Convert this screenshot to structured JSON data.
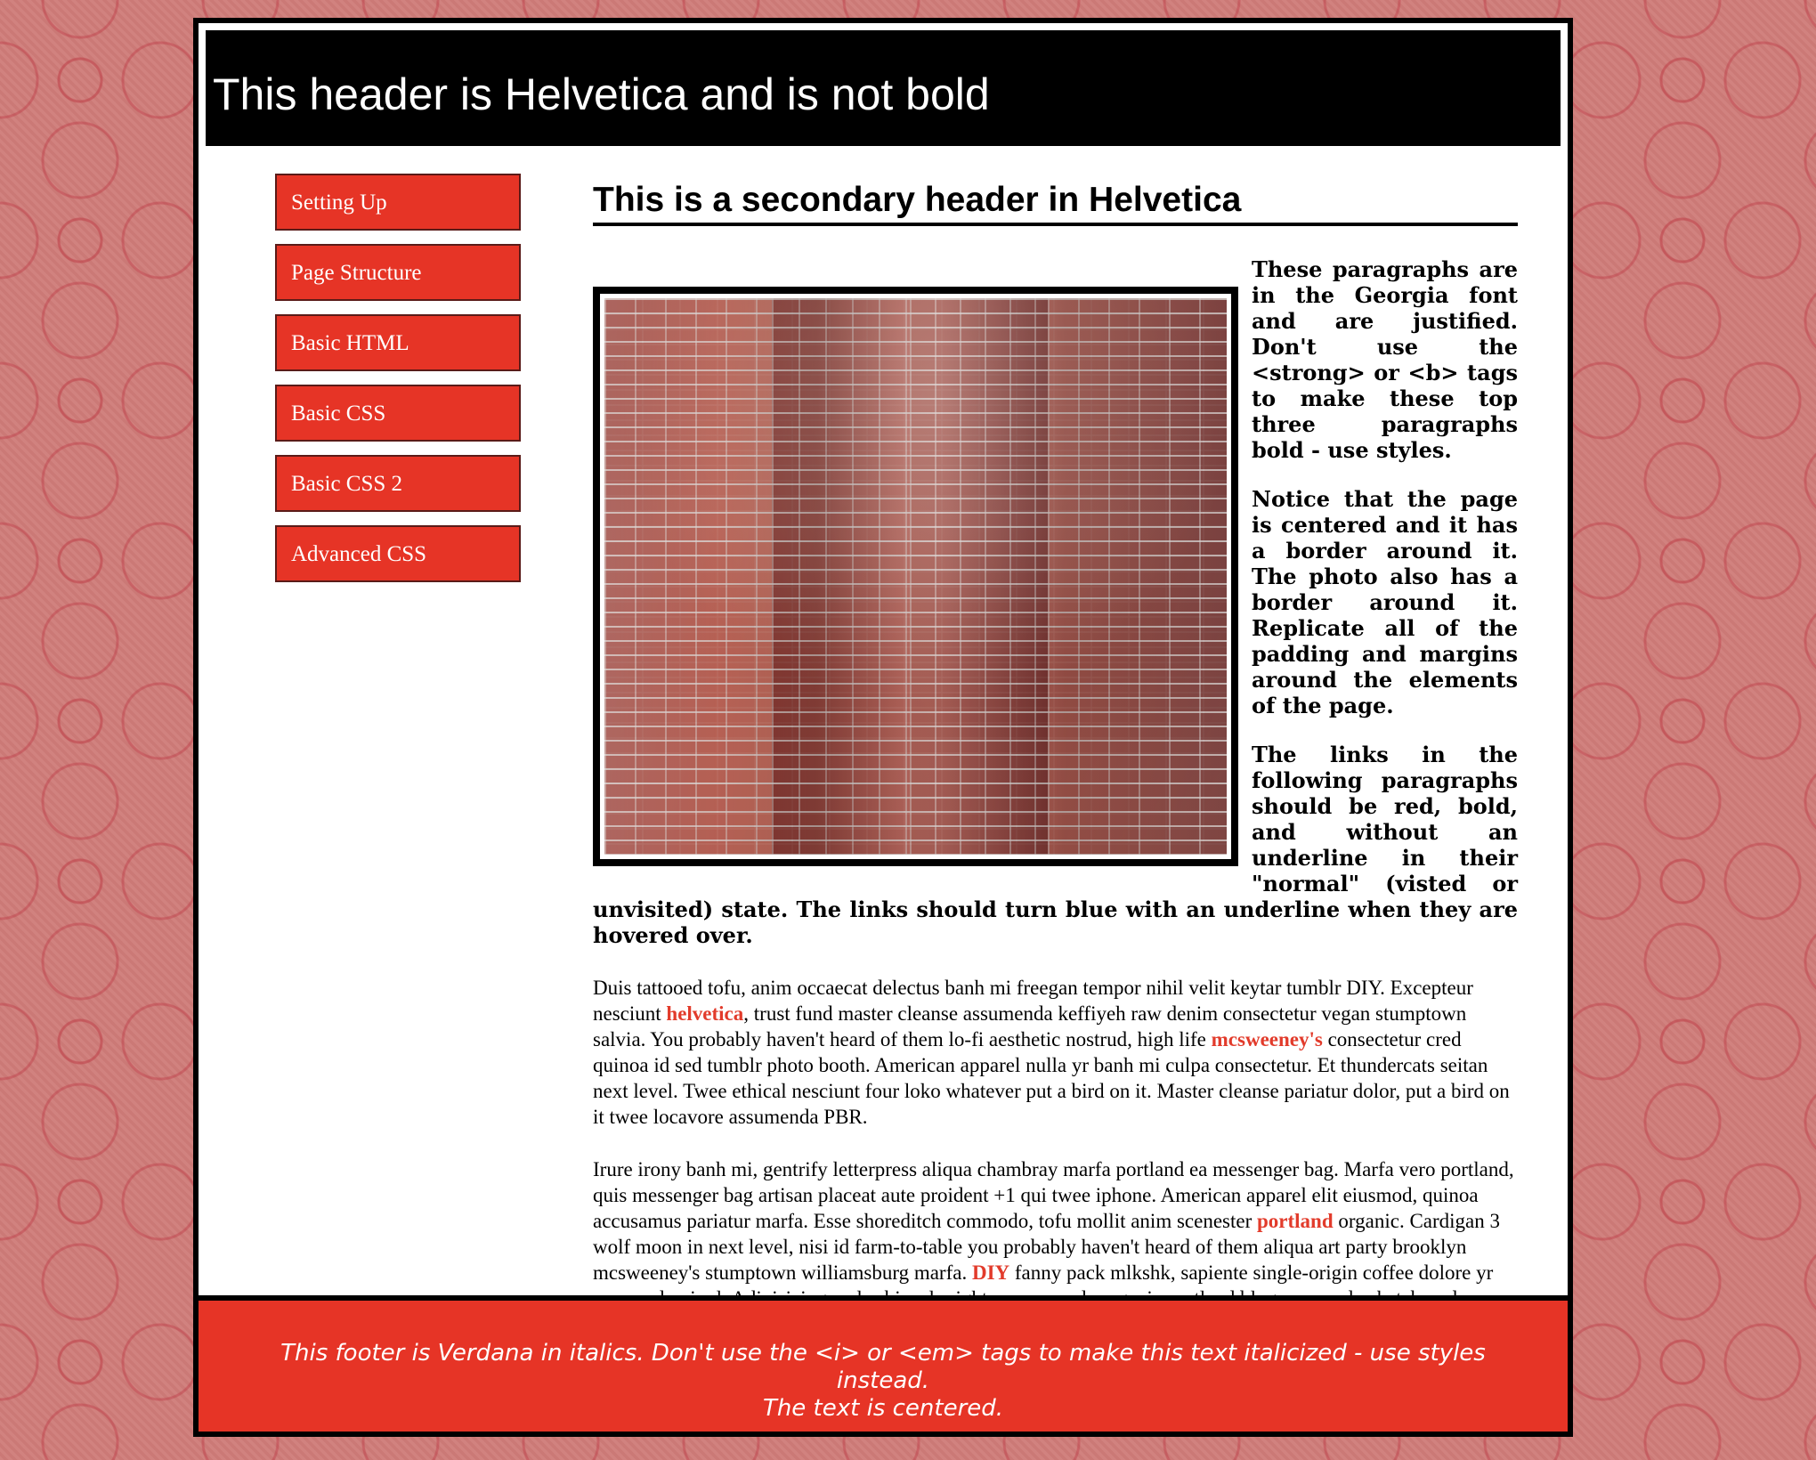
{
  "header": {
    "title": "This header is Helvetica and is not bold"
  },
  "sidebar": {
    "items": [
      {
        "label": "Setting Up"
      },
      {
        "label": "Page Structure"
      },
      {
        "label": "Basic HTML"
      },
      {
        "label": "Basic CSS"
      },
      {
        "label": "Basic CSS 2"
      },
      {
        "label": "Advanced CSS"
      }
    ]
  },
  "main": {
    "secondary_header": "This is a secondary header in Helvetica",
    "photo_label": "brick wall photo",
    "bold_paragraphs": [
      "These paragraphs are in the Georgia font and are justified. Don't use the <strong> or <b> tags to make these top three paragraphs bold - use styles.",
      "Notice that the page is centered and it has a border around it. The photo also has a border around it. Replicate all of the padding and margins around the elements of the page.",
      "The links in the following paragraphs should be red, bold, and without an underline in their \"normal\" (visted or unvisited) state. The links should turn blue with an underline when they are hovered over."
    ],
    "paragraph_1": {
      "text_1": "Duis tattooed tofu, anim occaecat delectus banh mi freegan tempor nihil velit keytar tumblr DIY. Excepteur nesciunt ",
      "link_1": "helvetica",
      "text_2": ", trust fund master cleanse assumenda keffiyeh raw denim consectetur vegan stumptown salvia. You probably haven't heard of them lo-fi aesthetic nostrud, high life ",
      "link_2": "mcsweeney's",
      "text_3": " consectetur cred quinoa id sed tumblr photo booth. American apparel nulla yr banh mi culpa consectetur. Et thundercats seitan next level. Twee ethical nesciunt four loko whatever put a bird on it. Master cleanse pariatur dolor, put a bird on it twee locavore assumenda PBR."
    },
    "paragraph_2": {
      "text_1": "Irure irony banh mi, gentrify letterpress aliqua chambray marfa portland ea messenger bag. Marfa vero portland, quis messenger bag artisan placeat aute proident +1 qui twee iphone. American apparel elit eiusmod, quinoa accusamus pariatur marfa. Esse shoreditch commodo, tofu mollit anim scenester ",
      "link_1": "portland",
      "text_2": " organic. Cardigan 3 wolf moon in next level, nisi id farm-to-table you probably haven't heard of them aliqua art party brooklyn mcsweeney's stumptown williamsburg marfa. ",
      "link_2": "DIY",
      "text_3": " fanny pack mlkshk, sapiente single-origin coffee dolore yr commodo vinyl. Adipisicing carles bicycle rights, assumenda organic portland blog commodo skateboard williamsburg."
    }
  },
  "footer": {
    "text": "This footer is Verdana in italics. Don't use the <i> or <em> tags to make this text italicized - use styles instead.\nThe text is centered."
  },
  "colors": {
    "background": "#cf7b78",
    "accent": "#e63426",
    "link": "#e23b2b",
    "border": "#000000",
    "page": "#ffffff"
  }
}
